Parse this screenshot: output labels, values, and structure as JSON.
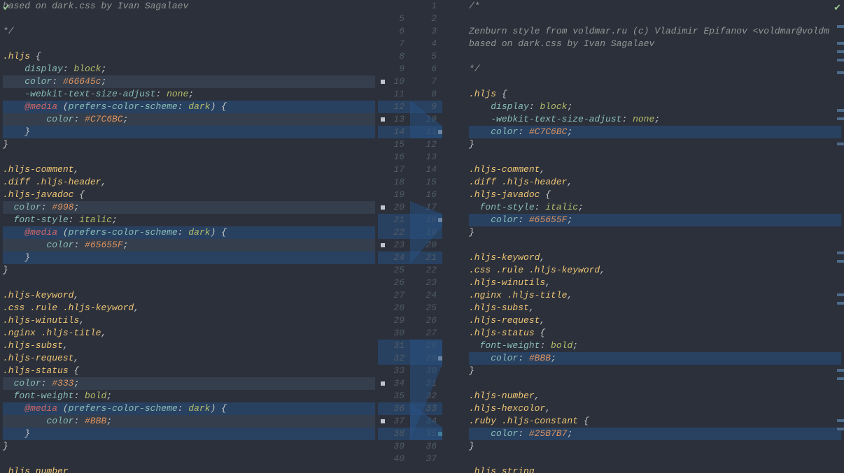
{
  "leftLines": [
    {
      "t": [
        {
          "s": "com",
          "v": "based on dark.css by Ivan Sagalaev"
        }
      ]
    },
    {
      "t": []
    },
    {
      "t": [
        {
          "s": "com",
          "v": "*/"
        }
      ]
    },
    {
      "t": []
    },
    {
      "t": [
        {
          "s": "sel",
          "v": ".hljs"
        },
        {
          "s": "pun",
          "v": " {"
        }
      ]
    },
    {
      "t": [
        {
          "s": "",
          "v": "    "
        },
        {
          "s": "prop",
          "v": "display"
        },
        {
          "s": "pun",
          "v": ": "
        },
        {
          "s": "val",
          "v": "block"
        },
        {
          "s": "pun",
          "v": ";"
        }
      ]
    },
    {
      "t": [
        {
          "s": "",
          "v": "    "
        },
        {
          "s": "prop",
          "v": "color"
        },
        {
          "s": "pun",
          "v": ": "
        },
        {
          "s": "hex",
          "v": "#66645c"
        },
        {
          "s": "pun",
          "v": ";"
        }
      ],
      "hl": "hl-mod"
    },
    {
      "t": [
        {
          "s": "",
          "v": "    "
        },
        {
          "s": "prop",
          "v": "-webkit-text-size-adjust"
        },
        {
          "s": "pun",
          "v": ": "
        },
        {
          "s": "val",
          "v": "none"
        },
        {
          "s": "pun",
          "v": ";"
        }
      ]
    },
    {
      "t": [
        {
          "s": "",
          "v": "    "
        },
        {
          "s": "kw",
          "v": "@media"
        },
        {
          "s": "pun",
          "v": " ("
        },
        {
          "s": "prop",
          "v": "prefers-color-scheme"
        },
        {
          "s": "pun",
          "v": ": "
        },
        {
          "s": "val",
          "v": "dark"
        },
        {
          "s": "pun",
          "v": ") {"
        }
      ],
      "hl": "hl-strong"
    },
    {
      "t": [
        {
          "s": "",
          "v": "        "
        },
        {
          "s": "prop",
          "v": "color"
        },
        {
          "s": "pun",
          "v": ": "
        },
        {
          "s": "hex",
          "v": "#C7C6BC"
        },
        {
          "s": "pun",
          "v": ";"
        }
      ],
      "hl": "hl-mod"
    },
    {
      "t": [
        {
          "s": "",
          "v": "    "
        },
        {
          "s": "pun",
          "v": "}"
        }
      ],
      "hl": "hl-strong"
    },
    {
      "t": [
        {
          "s": "pun",
          "v": "}"
        }
      ]
    },
    {
      "t": []
    },
    {
      "t": [
        {
          "s": "sel",
          "v": ".hljs-comment"
        },
        {
          "s": "pun",
          "v": ","
        }
      ]
    },
    {
      "t": [
        {
          "s": "sel",
          "v": ".diff .hljs-header"
        },
        {
          "s": "pun",
          "v": ","
        }
      ]
    },
    {
      "t": [
        {
          "s": "sel",
          "v": ".hljs-javadoc"
        },
        {
          "s": "pun",
          "v": " {"
        }
      ]
    },
    {
      "t": [
        {
          "s": "",
          "v": "  "
        },
        {
          "s": "prop",
          "v": "color"
        },
        {
          "s": "pun",
          "v": ": "
        },
        {
          "s": "hex",
          "v": "#998"
        },
        {
          "s": "pun",
          "v": ";"
        }
      ],
      "hl": "hl-mod"
    },
    {
      "t": [
        {
          "s": "",
          "v": "  "
        },
        {
          "s": "prop",
          "v": "font-style"
        },
        {
          "s": "pun",
          "v": ": "
        },
        {
          "s": "val",
          "v": "italic"
        },
        {
          "s": "pun",
          "v": ";"
        }
      ]
    },
    {
      "t": [
        {
          "s": "",
          "v": "    "
        },
        {
          "s": "kw",
          "v": "@media"
        },
        {
          "s": "pun",
          "v": " ("
        },
        {
          "s": "prop",
          "v": "prefers-color-scheme"
        },
        {
          "s": "pun",
          "v": ": "
        },
        {
          "s": "val",
          "v": "dark"
        },
        {
          "s": "pun",
          "v": ") {"
        }
      ],
      "hl": "hl-strong"
    },
    {
      "t": [
        {
          "s": "",
          "v": "        "
        },
        {
          "s": "prop",
          "v": "color"
        },
        {
          "s": "pun",
          "v": ": "
        },
        {
          "s": "hex",
          "v": "#65655F"
        },
        {
          "s": "pun",
          "v": ";"
        }
      ],
      "hl": "hl-mod"
    },
    {
      "t": [
        {
          "s": "",
          "v": "    "
        },
        {
          "s": "pun",
          "v": "}"
        }
      ],
      "hl": "hl-strong"
    },
    {
      "t": [
        {
          "s": "pun",
          "v": "}"
        }
      ]
    },
    {
      "t": []
    },
    {
      "t": [
        {
          "s": "sel",
          "v": ".hljs-keyword"
        },
        {
          "s": "pun",
          "v": ","
        }
      ]
    },
    {
      "t": [
        {
          "s": "sel",
          "v": ".css .rule .hljs-keyword"
        },
        {
          "s": "pun",
          "v": ","
        }
      ]
    },
    {
      "t": [
        {
          "s": "sel",
          "v": ".hljs-winutils"
        },
        {
          "s": "pun",
          "v": ","
        }
      ]
    },
    {
      "t": [
        {
          "s": "sel",
          "v": ".nginx .hljs-title"
        },
        {
          "s": "pun",
          "v": ","
        }
      ]
    },
    {
      "t": [
        {
          "s": "sel",
          "v": ".hljs-subst"
        },
        {
          "s": "pun",
          "v": ","
        }
      ]
    },
    {
      "t": [
        {
          "s": "sel",
          "v": ".hljs-request"
        },
        {
          "s": "pun",
          "v": ","
        }
      ]
    },
    {
      "t": [
        {
          "s": "sel",
          "v": ".hljs-status"
        },
        {
          "s": "pun",
          "v": " {"
        }
      ]
    },
    {
      "t": [
        {
          "s": "",
          "v": "  "
        },
        {
          "s": "prop",
          "v": "color"
        },
        {
          "s": "pun",
          "v": ": "
        },
        {
          "s": "hex",
          "v": "#333"
        },
        {
          "s": "pun",
          "v": ";"
        }
      ],
      "hl": "hl-mod"
    },
    {
      "t": [
        {
          "s": "",
          "v": "  "
        },
        {
          "s": "prop",
          "v": "font-weight"
        },
        {
          "s": "pun",
          "v": ": "
        },
        {
          "s": "val",
          "v": "bold"
        },
        {
          "s": "pun",
          "v": ";"
        }
      ]
    },
    {
      "t": [
        {
          "s": "",
          "v": "    "
        },
        {
          "s": "kw",
          "v": "@media"
        },
        {
          "s": "pun",
          "v": " ("
        },
        {
          "s": "prop",
          "v": "prefers-color-scheme"
        },
        {
          "s": "pun",
          "v": ": "
        },
        {
          "s": "val",
          "v": "dark"
        },
        {
          "s": "pun",
          "v": ") {"
        }
      ],
      "hl": "hl-strong"
    },
    {
      "t": [
        {
          "s": "",
          "v": "        "
        },
        {
          "s": "prop",
          "v": "color"
        },
        {
          "s": "pun",
          "v": ": "
        },
        {
          "s": "hex",
          "v": "#BBB"
        },
        {
          "s": "pun",
          "v": ";"
        }
      ],
      "hl": "hl-mod"
    },
    {
      "t": [
        {
          "s": "",
          "v": "    "
        },
        {
          "s": "pun",
          "v": "}"
        }
      ],
      "hl": "hl-strong"
    },
    {
      "t": [
        {
          "s": "pun",
          "v": "}"
        }
      ]
    },
    {
      "t": []
    },
    {
      "t": [
        {
          "s": "sel",
          "v": " hljs number"
        }
      ]
    }
  ],
  "rightLines": [
    {
      "t": [
        {
          "s": "com",
          "v": "/*"
        }
      ]
    },
    {
      "t": []
    },
    {
      "t": [
        {
          "s": "com",
          "v": "Zenburn style from voldmar.ru (c) Vladimir Epifanov <voldmar@voldm"
        }
      ]
    },
    {
      "t": [
        {
          "s": "com",
          "v": "based on dark.css by Ivan Sagalaev"
        }
      ]
    },
    {
      "t": []
    },
    {
      "t": [
        {
          "s": "com",
          "v": "*/"
        }
      ]
    },
    {
      "t": []
    },
    {
      "t": [
        {
          "s": "sel",
          "v": ".hljs"
        },
        {
          "s": "pun",
          "v": " {"
        }
      ]
    },
    {
      "t": [
        {
          "s": "",
          "v": "    "
        },
        {
          "s": "prop",
          "v": "display"
        },
        {
          "s": "pun",
          "v": ": "
        },
        {
          "s": "val",
          "v": "block"
        },
        {
          "s": "pun",
          "v": ";"
        }
      ]
    },
    {
      "t": [
        {
          "s": "",
          "v": "    "
        },
        {
          "s": "prop",
          "v": "-webkit-text-size-adjust"
        },
        {
          "s": "pun",
          "v": ": "
        },
        {
          "s": "val",
          "v": "none"
        },
        {
          "s": "pun",
          "v": ";"
        }
      ]
    },
    {
      "t": [
        {
          "s": "",
          "v": "    "
        },
        {
          "s": "prop",
          "v": "color"
        },
        {
          "s": "pun",
          "v": ": "
        },
        {
          "s": "hex",
          "v": "#C7C6BC"
        },
        {
          "s": "pun",
          "v": ";"
        }
      ],
      "hl": "hl-strong"
    },
    {
      "t": [
        {
          "s": "pun",
          "v": "}"
        }
      ]
    },
    {
      "t": []
    },
    {
      "t": [
        {
          "s": "sel",
          "v": ".hljs-comment"
        },
        {
          "s": "pun",
          "v": ","
        }
      ]
    },
    {
      "t": [
        {
          "s": "sel",
          "v": ".diff .hljs-header"
        },
        {
          "s": "pun",
          "v": ","
        }
      ]
    },
    {
      "t": [
        {
          "s": "sel",
          "v": ".hljs-javadoc"
        },
        {
          "s": "pun",
          "v": " {"
        }
      ]
    },
    {
      "t": [
        {
          "s": "",
          "v": "  "
        },
        {
          "s": "prop",
          "v": "font-style"
        },
        {
          "s": "pun",
          "v": ": "
        },
        {
          "s": "val",
          "v": "italic"
        },
        {
          "s": "pun",
          "v": ";"
        }
      ]
    },
    {
      "t": [
        {
          "s": "",
          "v": "    "
        },
        {
          "s": "prop",
          "v": "color"
        },
        {
          "s": "pun",
          "v": ": "
        },
        {
          "s": "hex",
          "v": "#65655F"
        },
        {
          "s": "pun",
          "v": ";"
        }
      ],
      "hl": "hl-strong"
    },
    {
      "t": [
        {
          "s": "pun",
          "v": "}"
        }
      ]
    },
    {
      "t": []
    },
    {
      "t": [
        {
          "s": "sel",
          "v": ".hljs-keyword"
        },
        {
          "s": "pun",
          "v": ","
        }
      ]
    },
    {
      "t": [
        {
          "s": "sel",
          "v": ".css .rule .hljs-keyword"
        },
        {
          "s": "pun",
          "v": ","
        }
      ]
    },
    {
      "t": [
        {
          "s": "sel",
          "v": ".hljs-winutils"
        },
        {
          "s": "pun",
          "v": ","
        }
      ]
    },
    {
      "t": [
        {
          "s": "sel",
          "v": ".nginx .hljs-title"
        },
        {
          "s": "pun",
          "v": ","
        }
      ]
    },
    {
      "t": [
        {
          "s": "sel",
          "v": ".hljs-subst"
        },
        {
          "s": "pun",
          "v": ","
        }
      ]
    },
    {
      "t": [
        {
          "s": "sel",
          "v": ".hljs-request"
        },
        {
          "s": "pun",
          "v": ","
        }
      ]
    },
    {
      "t": [
        {
          "s": "sel",
          "v": ".hljs-status"
        },
        {
          "s": "pun",
          "v": " {"
        }
      ]
    },
    {
      "t": [
        {
          "s": "",
          "v": "  "
        },
        {
          "s": "prop",
          "v": "font-weight"
        },
        {
          "s": "pun",
          "v": ": "
        },
        {
          "s": "val",
          "v": "bold"
        },
        {
          "s": "pun",
          "v": ";"
        }
      ]
    },
    {
      "t": [
        {
          "s": "",
          "v": "    "
        },
        {
          "s": "prop",
          "v": "color"
        },
        {
          "s": "pun",
          "v": ": "
        },
        {
          "s": "hex",
          "v": "#BBB"
        },
        {
          "s": "pun",
          "v": ";"
        }
      ],
      "hl": "hl-strong"
    },
    {
      "t": [
        {
          "s": "pun",
          "v": "}"
        }
      ]
    },
    {
      "t": []
    },
    {
      "t": [
        {
          "s": "sel",
          "v": ".hljs-number"
        },
        {
          "s": "pun",
          "v": ","
        }
      ]
    },
    {
      "t": [
        {
          "s": "sel",
          "v": ".hljs-hexcolor"
        },
        {
          "s": "pun",
          "v": ","
        }
      ]
    },
    {
      "t": [
        {
          "s": "sel",
          "v": ".ruby .hljs-constant"
        },
        {
          "s": "pun",
          "v": " {"
        }
      ]
    },
    {
      "t": [
        {
          "s": "",
          "v": "    "
        },
        {
          "s": "prop",
          "v": "color"
        },
        {
          "s": "pun",
          "v": ": "
        },
        {
          "s": "hex",
          "v": "#25B7B7"
        },
        {
          "s": "pun",
          "v": ";"
        }
      ],
      "hl": "hl-strong"
    },
    {
      "t": [
        {
          "s": "pun",
          "v": "}"
        }
      ]
    },
    {
      "t": []
    },
    {
      "t": [
        {
          "s": "sel",
          "v": " hljs string"
        }
      ]
    }
  ],
  "gutter": [
    {
      "l": "",
      "r": "1"
    },
    {
      "l": "5",
      "r": "2"
    },
    {
      "l": "6",
      "r": "3"
    },
    {
      "l": "7",
      "r": "4"
    },
    {
      "l": "8",
      "r": "5"
    },
    {
      "l": "9",
      "r": "6"
    },
    {
      "l": "10",
      "r": "7",
      "sq": "white"
    },
    {
      "l": "11",
      "r": "8"
    },
    {
      "l": "12",
      "r": "9",
      "add": true
    },
    {
      "l": "13",
      "r": "10",
      "sq": "white"
    },
    {
      "l": "14",
      "r": "11",
      "add": true,
      "rt": "white"
    },
    {
      "l": "15",
      "r": "12"
    },
    {
      "l": "16",
      "r": "13"
    },
    {
      "l": "17",
      "r": "14"
    },
    {
      "l": "18",
      "r": "15"
    },
    {
      "l": "19",
      "r": "16"
    },
    {
      "l": "20",
      "r": "17",
      "sq": "white"
    },
    {
      "l": "21",
      "r": "18",
      "add": true,
      "rt": "white"
    },
    {
      "l": "22",
      "r": "19",
      "add": true
    },
    {
      "l": "23",
      "r": "20",
      "sq": "white"
    },
    {
      "l": "24",
      "r": "21",
      "add": true
    },
    {
      "l": "25",
      "r": "22"
    },
    {
      "l": "26",
      "r": "23"
    },
    {
      "l": "27",
      "r": "24"
    },
    {
      "l": "28",
      "r": "25"
    },
    {
      "l": "29",
      "r": "26"
    },
    {
      "l": "30",
      "r": "27"
    },
    {
      "l": "31",
      "r": "28",
      "add": true
    },
    {
      "l": "32",
      "r": "29",
      "add": true,
      "rt": "white"
    },
    {
      "l": "33",
      "r": "30"
    },
    {
      "l": "34",
      "r": "31",
      "sq": "white"
    },
    {
      "l": "35",
      "r": "32"
    },
    {
      "l": "36",
      "r": "33",
      "add": true
    },
    {
      "l": "37",
      "r": "34",
      "sq": "white"
    },
    {
      "l": "38",
      "r": "35",
      "add": true,
      "rt": "teal"
    },
    {
      "l": "39",
      "r": "36"
    },
    {
      "l": "40",
      "r": "37"
    },
    {
      "l": "",
      "r": ""
    }
  ],
  "checks": {
    "left": "✔",
    "right": "✔"
  },
  "minimapLeft": [
    6,
    8,
    16,
    18,
    30,
    32,
    36
  ],
  "minimapRight": [
    6,
    10,
    12,
    14,
    17,
    26,
    28,
    34,
    60,
    62,
    70,
    72,
    88,
    90,
    100,
    102
  ]
}
